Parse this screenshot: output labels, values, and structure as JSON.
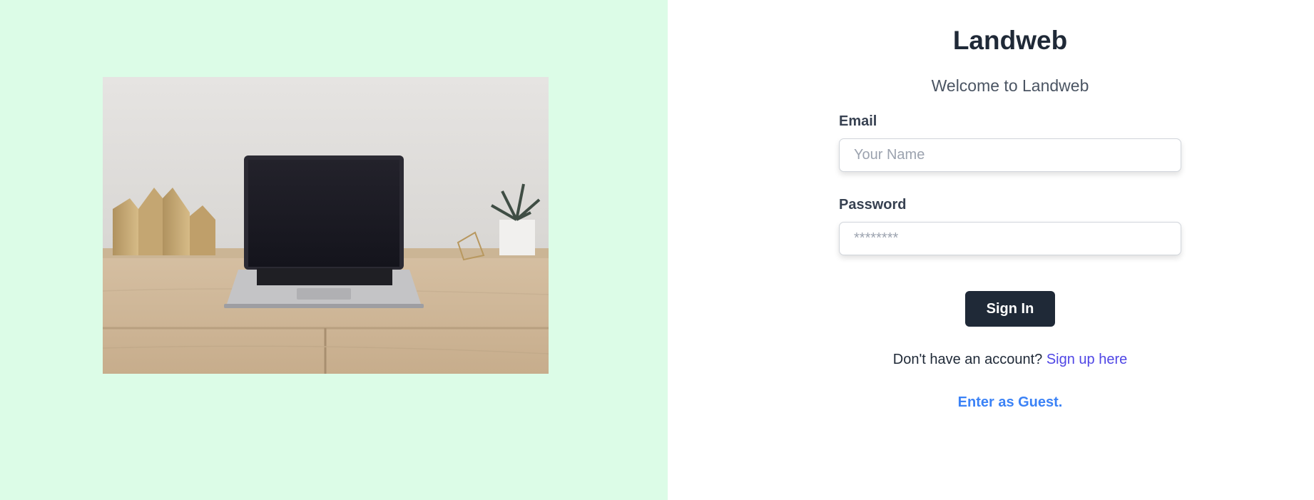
{
  "brand": {
    "title": "Landweb",
    "welcome": "Welcome to Landweb"
  },
  "form": {
    "email_label": "Email",
    "email_placeholder": "Your Name",
    "email_value": "",
    "password_label": "Password",
    "password_placeholder": "********",
    "password_value": "",
    "submit_label": "Sign In"
  },
  "footer": {
    "signup_prompt": "Don't have an account?",
    "signup_link": "Sign up here",
    "guest_link": "Enter as Guest."
  },
  "colors": {
    "left_panel_bg": "#dcfce7",
    "button_bg": "#1f2937",
    "signup_link": "#4f46e5",
    "guest_link": "#3b82f6"
  },
  "hero_image": {
    "icon": "laptop-desk-photo"
  }
}
